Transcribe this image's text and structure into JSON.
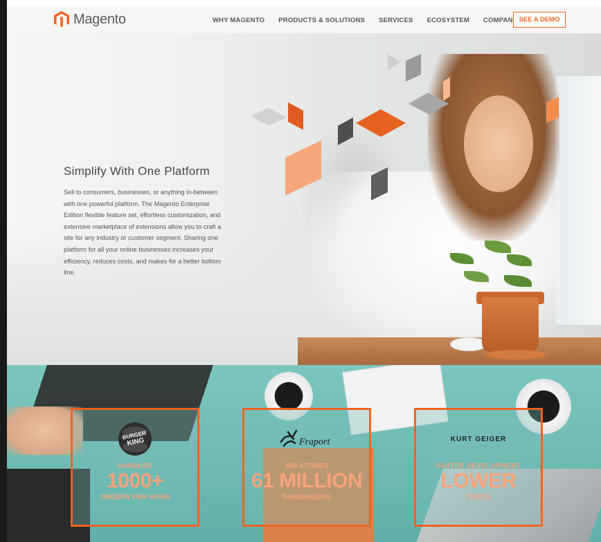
{
  "header": {
    "logo_text": "Magento",
    "nav": [
      "WHY MAGENTO",
      "PRODUCTS & SOLUTIONS",
      "SERVICES",
      "ECOSYSTEM",
      "COMPANY"
    ],
    "demo_label": "SEE A DEMO"
  },
  "hero": {
    "title": "Simplify With One Platform",
    "text": "Sell to consumers, businesses, or anything in-between with one powerful platform. The Magento Enterprise Edition flexible feature set, effortless customization, and extensive marketplace of extensions allow you to craft a site for any industry or customer segment. Sharing one platform for all your online businesses increases your efficiency, reduces costs, and makes for a better bottom line."
  },
  "stats": [
    {
      "brand": "BURGER KING",
      "top": "HANDLES",
      "big": "1000+",
      "bottom": "ORDERS PER HOUR"
    },
    {
      "brand": "Fraport",
      "top": "300 STORES",
      "big": "61 MILLION",
      "bottom": "PASSENGERS"
    },
    {
      "brand": "KURT GEIGER",
      "top": "FASTER DEVELOPMENT",
      "big": "LOWER",
      "bottom": "COSTS"
    }
  ],
  "colors": {
    "accent": "#f26322",
    "teal": "#6fbcb4",
    "text": "#555555"
  }
}
